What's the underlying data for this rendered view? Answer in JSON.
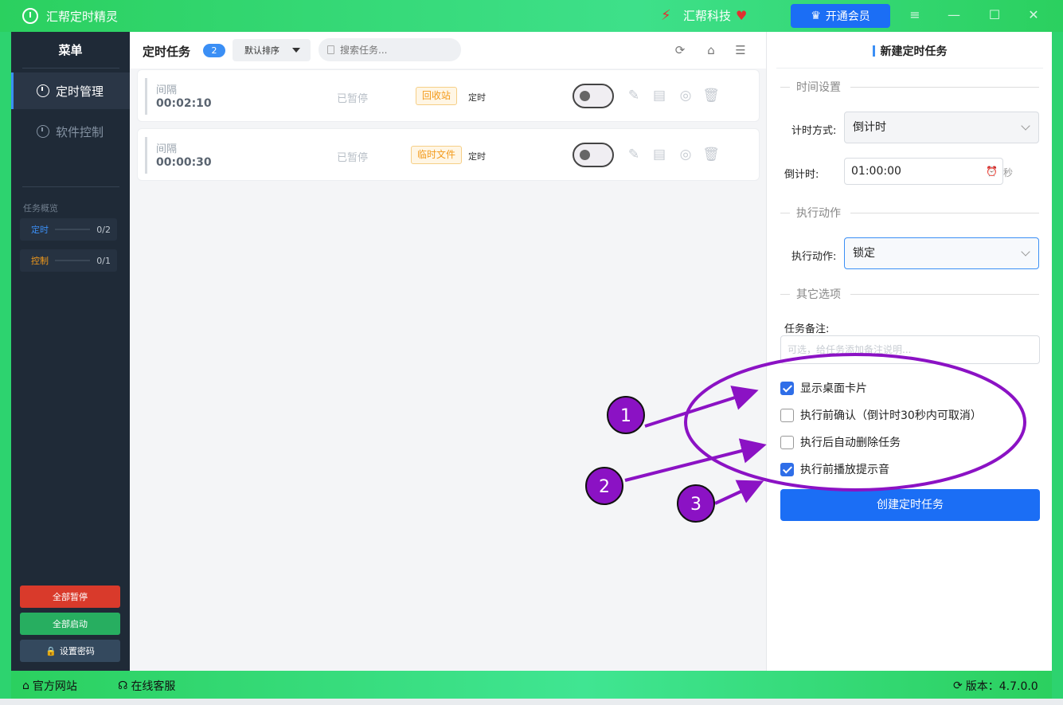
{
  "titlebar": {
    "app_title": "汇帮定时精灵",
    "brand": "汇帮科技",
    "vip_label": "开通会员"
  },
  "sidebar": {
    "menu_title": "菜单",
    "nav": [
      {
        "label": "定时管理",
        "active": true
      },
      {
        "label": "软件控制",
        "active": false
      }
    ],
    "overview_label": "任务概览",
    "overview": [
      {
        "label": "定时",
        "count": "0/2",
        "color": "#3b8ff5"
      },
      {
        "label": "控制",
        "count": "0/1",
        "color": "#f39a1b"
      }
    ],
    "buttons": {
      "pause_all": "全部暂停",
      "start_all": "全部启动",
      "set_password": "设置密码"
    }
  },
  "main": {
    "title": "定时任务",
    "count": "2",
    "sort_label": "默认排序",
    "search_placeholder": "搜索任务...",
    "tasks": [
      {
        "type": "间隔",
        "time": "00:02:10",
        "status": "已暂停",
        "tag": "回收站",
        "kind": "定时"
      },
      {
        "type": "间隔",
        "time": "00:00:30",
        "status": "已暂停",
        "tag": "临时文件",
        "kind": "定时"
      }
    ]
  },
  "right_panel": {
    "title": "新建定时任务",
    "section_time": "时间设置",
    "timer_mode_label": "计时方式:",
    "timer_mode_value": "倒计时",
    "countdown_label": "倒计时:",
    "countdown_value": "01:00:00",
    "countdown_unit": "秒",
    "section_action": "执行动作",
    "action_label": "执行动作:",
    "action_value": "锁定",
    "section_other": "其它选项",
    "note_label": "任务备注:",
    "note_placeholder": "可选，给任务添加备注说明...",
    "options": [
      {
        "label": "显示桌面卡片",
        "checked": true
      },
      {
        "label": "执行前确认（倒计时30秒内可取消）",
        "checked": false
      },
      {
        "label": "执行后自动删除任务",
        "checked": false
      },
      {
        "label": "执行前播放提示音",
        "checked": true
      }
    ],
    "create_label": "创建定时任务"
  },
  "statusbar": {
    "website": "官方网站",
    "support": "在线客服",
    "version": "版本：4.7.0.0"
  },
  "annotations": {
    "markers": [
      "1",
      "2",
      "3"
    ],
    "color": "#8b12c4"
  },
  "colors": {
    "accent_green": "#2dd36f",
    "primary_blue": "#1b6ef5",
    "sidebar_bg": "#1f2a37",
    "danger_red": "#d93a2b",
    "success_green": "#27ae60"
  }
}
